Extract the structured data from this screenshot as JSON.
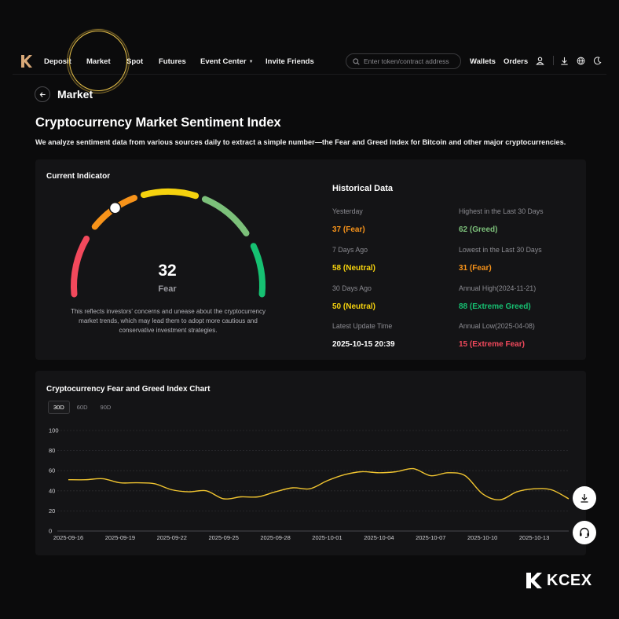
{
  "nav": {
    "items": [
      "Deposit",
      "Market",
      "Spot",
      "Futures",
      "Event Center",
      "Invite Friends"
    ],
    "search_placeholder": "Enter token/contract address",
    "wallets": "Wallets",
    "orders": "Orders"
  },
  "page": {
    "back_title": "Market",
    "title": "Cryptocurrency Market Sentiment Index",
    "description": "We analyze sentiment data from various sources daily to extract a simple number—the Fear and Greed Index for Bitcoin and other major cryptocurrencies."
  },
  "current_indicator": {
    "title": "Current Indicator",
    "value": 32,
    "value_text": "32",
    "label": "Fear",
    "description": "This reflects investors' concerns and unease about the cryptocurrency market trends, which may lead them to adopt more cautious and conservative investment strategies.",
    "colors": {
      "extreme_fear": "#f2495c",
      "fear": "#f7931a",
      "neutral": "#f5d20e",
      "greed": "#7cc07a",
      "extreme_greed": "#16c172"
    }
  },
  "historical": {
    "title": "Historical Data",
    "yesterday": {
      "label": "Yesterday",
      "value": "37 (Fear)",
      "color": "#f7931a"
    },
    "seven_days": {
      "label": "7 Days Ago",
      "value": "58 (Neutral)",
      "color": "#f5d20e"
    },
    "thirty_days": {
      "label": "30 Days Ago",
      "value": "50 (Neutral)",
      "color": "#f5d20e"
    },
    "latest_update": {
      "label": "Latest Update Time",
      "value": "2025-10-15 20:39",
      "color": "#ffffff"
    },
    "highest_30": {
      "label": "Highest in the Last 30 Days",
      "value": "62 (Greed)",
      "color": "#7cc07a"
    },
    "lowest_30": {
      "label": "Lowest in the Last 30 Days",
      "value": "31 (Fear)",
      "color": "#f7931a"
    },
    "annual_high": {
      "label": "Annual High(2024-11-21)",
      "value": "88 (Extreme Greed)",
      "color": "#16c172"
    },
    "annual_low": {
      "label": "Annual Low(2025-04-08)",
      "value": "15 (Extreme Fear)",
      "color": "#f2495c"
    }
  },
  "chart": {
    "title": "Cryptocurrency Fear and Greed Index Chart",
    "ranges": [
      "30D",
      "60D",
      "90D"
    ],
    "active_range": "30D"
  },
  "chart_data": {
    "type": "line",
    "ylim": [
      0,
      100
    ],
    "yticks": [
      0,
      20,
      40,
      60,
      80,
      100
    ],
    "xtick_labels": [
      "2025-09-16",
      "2025-09-19",
      "2025-09-22",
      "2025-09-25",
      "2025-09-28",
      "2025-10-01",
      "2025-10-04",
      "2025-10-07",
      "2025-10-10",
      "2025-10-13"
    ],
    "x": [
      "2025-09-16",
      "2025-09-17",
      "2025-09-18",
      "2025-09-19",
      "2025-09-20",
      "2025-09-21",
      "2025-09-22",
      "2025-09-23",
      "2025-09-24",
      "2025-09-25",
      "2025-09-26",
      "2025-09-27",
      "2025-09-28",
      "2025-09-29",
      "2025-09-30",
      "2025-10-01",
      "2025-10-02",
      "2025-10-03",
      "2025-10-04",
      "2025-10-05",
      "2025-10-06",
      "2025-10-07",
      "2025-10-08",
      "2025-10-09",
      "2025-10-10",
      "2025-10-11",
      "2025-10-12",
      "2025-10-13",
      "2025-10-14",
      "2025-10-15"
    ],
    "series": [
      {
        "color": "#f0c430",
        "values": [
          51,
          51,
          52,
          48,
          48,
          47,
          41,
          39,
          40,
          32,
          34,
          34,
          39,
          43,
          42,
          50,
          56,
          59,
          58,
          59,
          62,
          55,
          58,
          55,
          37,
          31,
          39,
          42,
          41,
          32
        ]
      }
    ],
    "grid": true
  },
  "brand": {
    "name": "KCEX"
  }
}
